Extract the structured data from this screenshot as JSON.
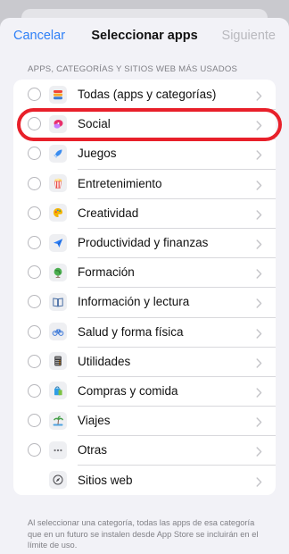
{
  "navbar": {
    "cancel_label": "Cancelar",
    "title": "Seleccionar apps",
    "next_label": "Siguiente"
  },
  "section_header": "APPS, CATEGORÍAS Y SITIOS WEB MÁS USADOS",
  "items": [
    {
      "label": "Todas (apps y categorías)",
      "icon": "stack-icon",
      "radio": true
    },
    {
      "label": "Social",
      "icon": "chat-bubbles-icon",
      "radio": true,
      "highlighted": true
    },
    {
      "label": "Juegos",
      "icon": "rocket-icon",
      "radio": true
    },
    {
      "label": "Entretenimiento",
      "icon": "popcorn-icon",
      "radio": true
    },
    {
      "label": "Creatividad",
      "icon": "palette-icon",
      "radio": true
    },
    {
      "label": "Productividad y finanzas",
      "icon": "paper-plane-icon",
      "radio": true
    },
    {
      "label": "Formación",
      "icon": "globe-icon",
      "radio": true
    },
    {
      "label": "Información y lectura",
      "icon": "book-icon",
      "radio": true
    },
    {
      "label": "Salud y forma física",
      "icon": "bicycle-icon",
      "radio": true
    },
    {
      "label": "Utilidades",
      "icon": "calculator-icon",
      "radio": true
    },
    {
      "label": "Compras y comida",
      "icon": "shopping-bag-icon",
      "radio": true
    },
    {
      "label": "Viajes",
      "icon": "palm-tree-icon",
      "radio": true
    },
    {
      "label": "Otras",
      "icon": "ellipsis-icon",
      "radio": true
    },
    {
      "label": "Sitios web",
      "icon": "compass-icon",
      "radio": false
    }
  ],
  "footer_text": "Al seleccionar una categoría, todas las apps de esa categoría que en un futuro se instalen desde App Store se incluirán en el límite de uso.",
  "colors": {
    "accent": "#2f80f7",
    "highlight": "#e8202a",
    "disabled": "#b9b9be"
  }
}
